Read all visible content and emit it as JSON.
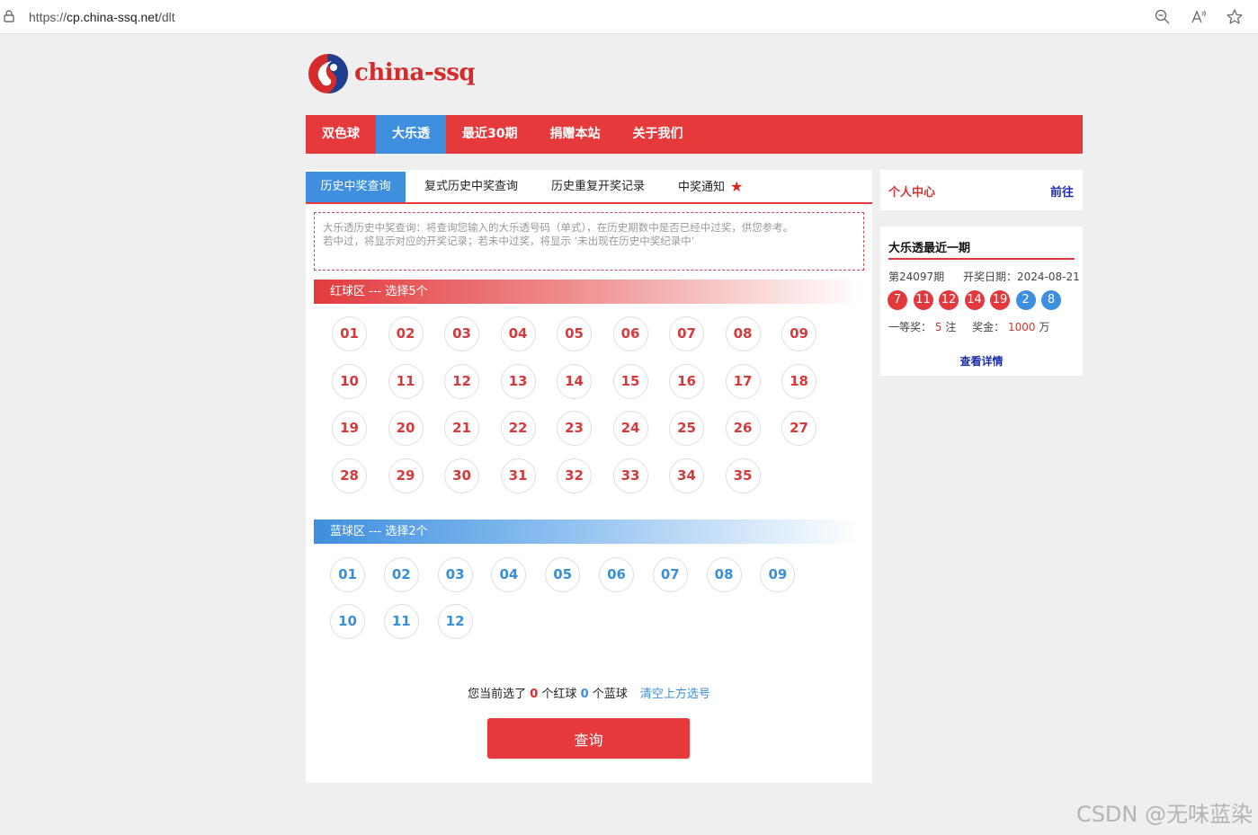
{
  "browser": {
    "url_scheme": "https://",
    "url_host": "cp.china-ssq.net",
    "url_path": "/dlt"
  },
  "logo": {
    "text": "china-ssq"
  },
  "nav": [
    {
      "label": "双色球"
    },
    {
      "label": "大乐透"
    },
    {
      "label": "最近30期"
    },
    {
      "label": "捐赠本站"
    },
    {
      "label": "关于我们"
    }
  ],
  "tabs": [
    {
      "label": "历史中奖查询"
    },
    {
      "label": "复式历史中奖查询"
    },
    {
      "label": "历史重复开奖记录"
    },
    {
      "label": "中奖通知"
    }
  ],
  "notice": {
    "line1": "大乐透历史中奖查询：将查询您输入的大乐透号码（单式），在历史期数中是否已经中过奖，供您参考。",
    "line2": "若中过，将显示对应的开奖记录；若未中过奖，将显示 ‘未出现在历史中奖纪录中’"
  },
  "red_zone": {
    "label": "红球区 --- 选择5个",
    "balls": [
      "01",
      "02",
      "03",
      "04",
      "05",
      "06",
      "07",
      "08",
      "09",
      "10",
      "11",
      "12",
      "13",
      "14",
      "15",
      "16",
      "17",
      "18",
      "19",
      "20",
      "21",
      "22",
      "23",
      "24",
      "25",
      "26",
      "27",
      "28",
      "29",
      "30",
      "31",
      "32",
      "33",
      "34",
      "35"
    ]
  },
  "blue_zone": {
    "label": "蓝球区 --- 选择2个",
    "balls": [
      "01",
      "02",
      "03",
      "04",
      "05",
      "06",
      "07",
      "08",
      "09",
      "10",
      "11",
      "12"
    ]
  },
  "summary": {
    "prefix": "您当前选了",
    "red_count": "0",
    "red_suffix": "个红球",
    "blue_count": "0",
    "blue_suffix": "个蓝球",
    "clear_label": "清空上方选号"
  },
  "query_button": "查询",
  "personal": {
    "title": "个人中心",
    "go": "前往"
  },
  "latest": {
    "title": "大乐透最近一期",
    "issue": "第24097期",
    "date": "开奖日期：2024-08-21",
    "red_numbers": [
      "7",
      "11",
      "12",
      "14",
      "19"
    ],
    "blue_numbers": [
      "2",
      "8"
    ],
    "prize_label": "一等奖：",
    "prize_count": "5",
    "prize_unit": "注",
    "amount_label": "奖金：",
    "amount": "1000",
    "amount_unit": "万",
    "details": "查看详情"
  },
  "watermark": "CSDN @无味蓝染",
  "colors": {
    "brand_red": "#e5393b",
    "brand_blue": "#3e8fde"
  }
}
